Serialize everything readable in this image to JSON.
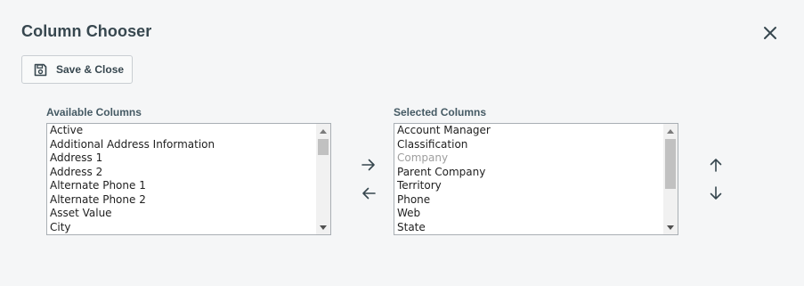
{
  "dialog": {
    "title": "Column Chooser",
    "close_icon": "close-icon"
  },
  "toolbar": {
    "save_label": "Save & Close",
    "save_icon": "floppy-disk-icon"
  },
  "available": {
    "label": "Available Columns",
    "items": [
      "Active",
      "Additional Address Information",
      "Address 1",
      "Address 2",
      "Alternate Phone 1",
      "Alternate Phone 2",
      "Asset Value",
      "City"
    ]
  },
  "selected": {
    "label": "Selected Columns",
    "items": [
      "Account Manager",
      "Classification",
      "Company",
      "Parent Company",
      "Territory",
      "Phone",
      "Web",
      "State"
    ],
    "disabled_items": [
      "Company"
    ]
  },
  "transfer": {
    "add_icon": "arrow-right-icon",
    "remove_icon": "arrow-left-icon"
  },
  "order": {
    "up_icon": "arrow-up-icon",
    "down_icon": "arrow-down-icon"
  },
  "colors": {
    "background": "#f5f6f7",
    "text": "#37474f",
    "disabled_text": "#9e9e9e",
    "border": "#a9afb4"
  }
}
